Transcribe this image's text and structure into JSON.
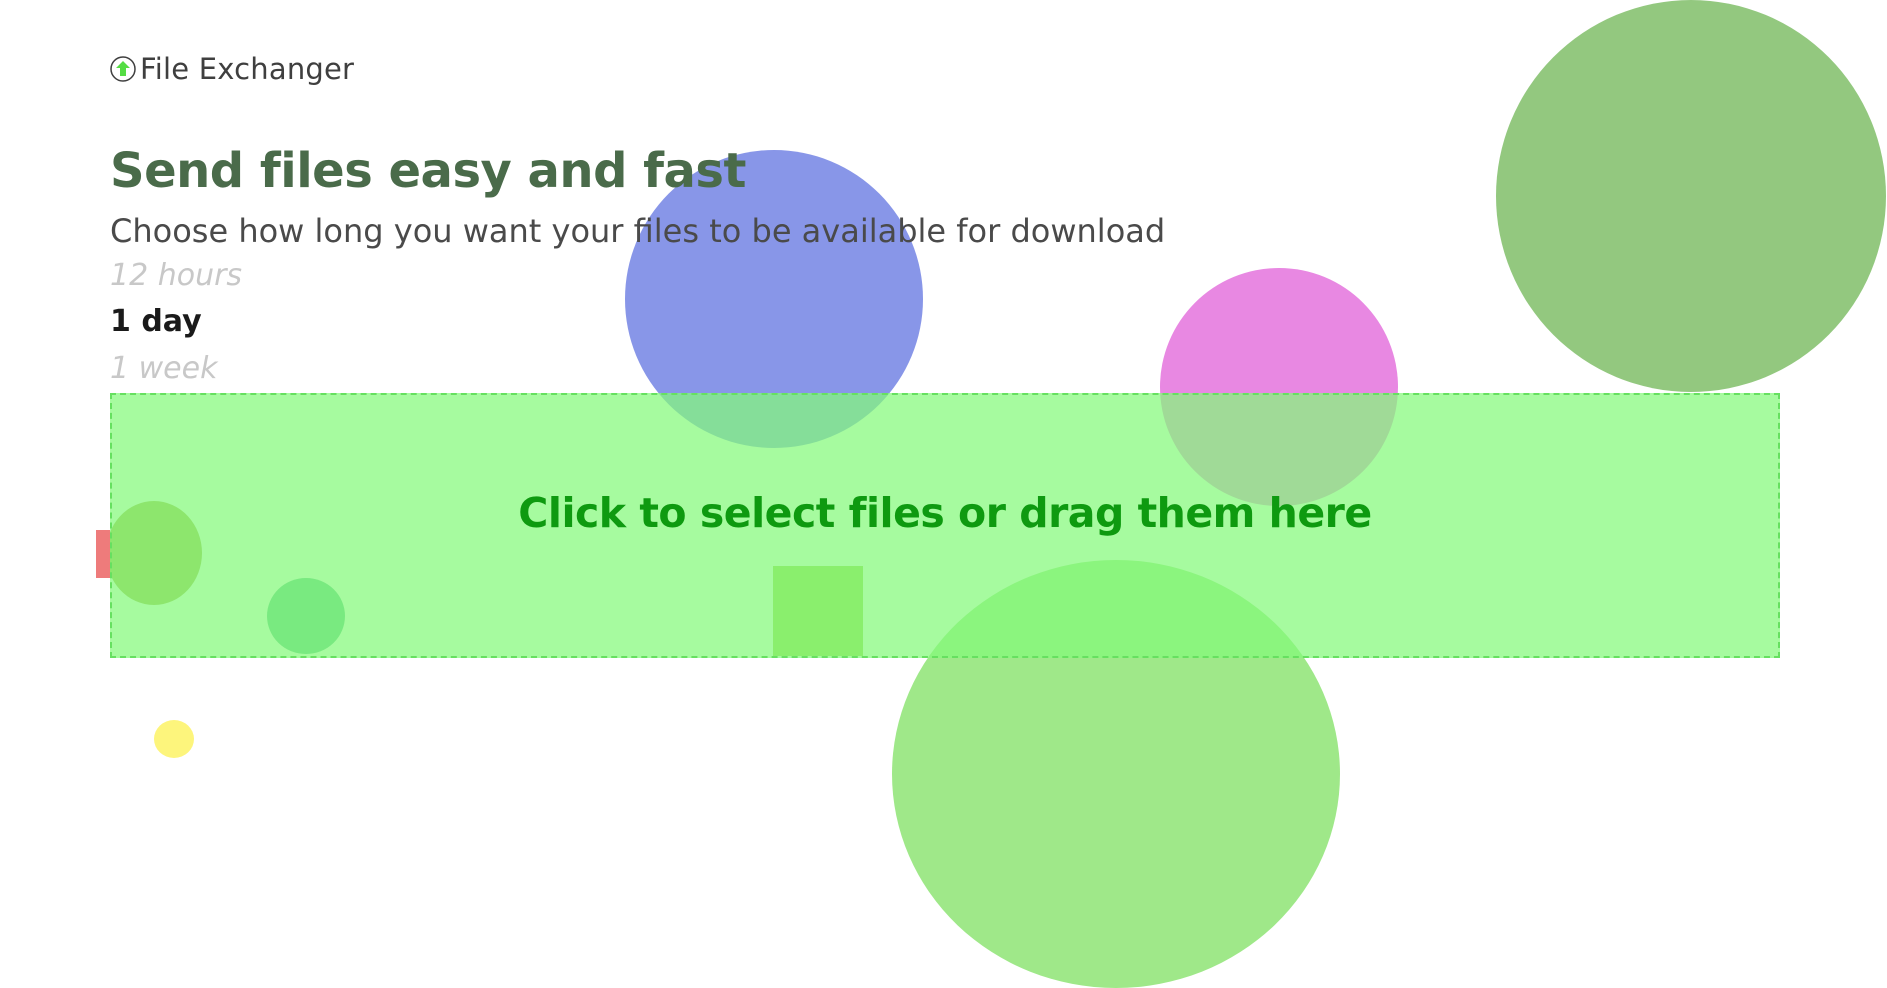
{
  "app": {
    "name": "File Exchanger",
    "logo_icon": "upload-arrow-icon"
  },
  "hero": {
    "title": "Send files easy and fast",
    "subtitle": "Choose how long you want your files to be available for download"
  },
  "durations": [
    {
      "label": "12 hours",
      "selected": false
    },
    {
      "label": "1 day",
      "selected": true
    },
    {
      "label": "1 week",
      "selected": false
    }
  ],
  "dropzone": {
    "label": "Click to select files or drag them here"
  },
  "colors": {
    "accent": "#0e9a10",
    "dropzone_bg": "#a3fc96",
    "title": "#4a6b4a"
  }
}
